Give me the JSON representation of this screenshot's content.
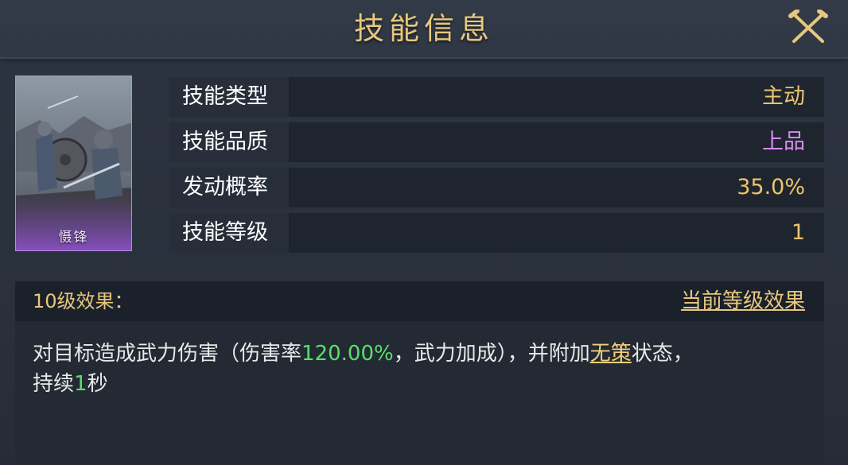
{
  "header": {
    "title": "技能信息"
  },
  "skill_card": {
    "name": "慑锋"
  },
  "info_rows": [
    {
      "label": "技能类型",
      "value": "主动"
    },
    {
      "label": "技能品质",
      "value": "上品"
    },
    {
      "label": "发动概率",
      "value": "35.0%"
    },
    {
      "label": "技能等级",
      "value": "1"
    }
  ],
  "effect": {
    "title": "10级效果：",
    "current_level_link": "当前等级效果",
    "desc_part1": "对目标造成武力伤害（伤害率",
    "damage_rate": "120.00%",
    "desc_part2": "，武力加成），并附加",
    "status_name": "无策",
    "desc_part3": "状态，",
    "desc_part4": "持续",
    "duration": "1",
    "desc_part5": "秒"
  },
  "colors": {
    "gold": "#e7c77e",
    "quality_purple": "#d58ef0",
    "highlight_green": "#57e06a"
  },
  "icons": {
    "close": "crossed-swords-close-icon"
  }
}
